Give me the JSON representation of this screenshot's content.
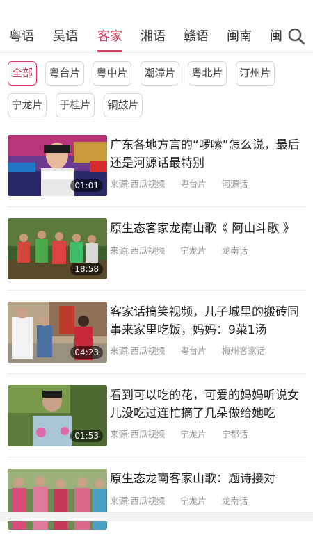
{
  "tabs": [
    "粤语",
    "吴语",
    "客家",
    "湘语",
    "赣语",
    "闽南",
    "闽"
  ],
  "active_tab": "客家",
  "chips": [
    "全部",
    "粤台片",
    "粤中片",
    "潮漳片",
    "粤北片",
    "汀州片",
    "宁龙片",
    "于桂片",
    "铜鼓片"
  ],
  "active_chip": "全部",
  "videos": [
    {
      "title": "广东各地方言的“啰嗦”怎么说，最后还是河源话最特别",
      "duration": "01:01",
      "source": "来源:西瓜视频",
      "tag1": "粤台片",
      "tag2": "河源话"
    },
    {
      "title": "原生态客家龙南山歌《 阿山斗歌 》",
      "duration": "18:58",
      "source": "来源:西瓜视频",
      "tag1": "宁龙片",
      "tag2": "龙南话"
    },
    {
      "title": "客家话搞笑视频，儿子城里的搬砖同事来家里吃饭，妈妈：9菜1汤",
      "duration": "04:23",
      "source": "来源:西瓜视频",
      "tag1": "粤台片",
      "tag2": "梅州客家话"
    },
    {
      "title": "看到可以吃的花，可爱的妈妈听说女儿没吃过连忙摘了几朵做给她吃",
      "duration": "01:53",
      "source": "来源:西瓜视频",
      "tag1": "宁龙片",
      "tag2": "宁都话"
    },
    {
      "title": "原生态龙南客家山歌：题诗接对",
      "duration": "",
      "source": "来源:西瓜视频",
      "tag1": "宁龙片",
      "tag2": "龙南话"
    }
  ],
  "colors": {
    "accent": "#d23c5f"
  }
}
